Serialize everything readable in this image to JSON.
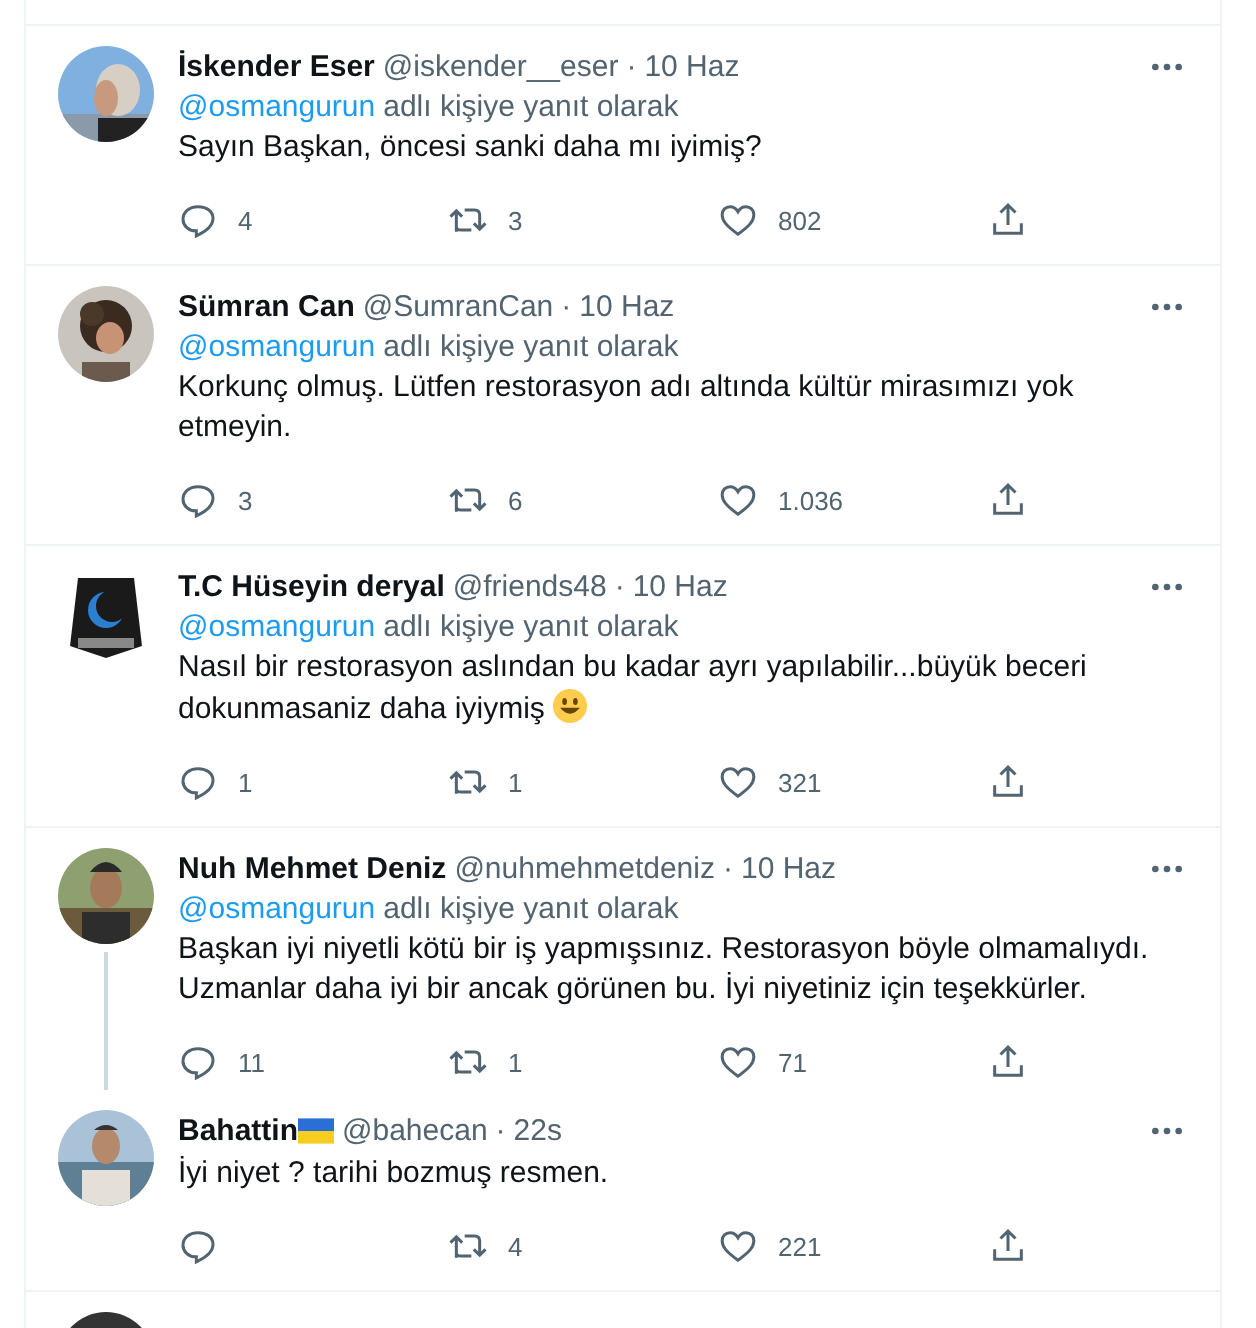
{
  "tweets": [
    {
      "name": "İskender Eser",
      "flag": false,
      "handle": "@iskender__eser",
      "time": "10 Haz",
      "reply_to": "@osmangurun",
      "reply_suffix": "adlı kişiye yanıt olarak",
      "text": "Sayın Başkan, öncesi sanki daha mı iyimiş?",
      "emoji": false,
      "replies": "4",
      "retweets": "3",
      "likes": "802",
      "thread_continues": false,
      "separator": "·"
    },
    {
      "name": "Sümran Can",
      "flag": false,
      "handle": "@SumranCan",
      "time": "10 Haz",
      "reply_to": "@osmangurun",
      "reply_suffix": "adlı kişiye yanıt olarak",
      "text": "Korkunç olmuş. Lütfen restorasyon adı altında kültür mirasımızı yok etmeyin.",
      "emoji": false,
      "replies": "3",
      "retweets": "6",
      "likes": "1.036",
      "thread_continues": false,
      "separator": "·"
    },
    {
      "name": "T.C Hüseyin deryal",
      "flag": false,
      "handle": "@friends48",
      "time": "10 Haz",
      "reply_to": "@osmangurun",
      "reply_suffix": "adlı kişiye yanıt olarak",
      "text": "Nasıl bir restorasyon aslından bu kadar ayrı yapılabilir...büyük beceri dokunmasaniz daha iyiymiş",
      "emoji": true,
      "replies": "1",
      "retweets": "1",
      "likes": "321",
      "thread_continues": false,
      "separator": "·"
    },
    {
      "name": "Nuh Mehmet Deniz",
      "flag": false,
      "handle": "@nuhmehmetdeniz",
      "time": "10 Haz",
      "reply_to": "@osmangurun",
      "reply_suffix": "adlı kişiye yanıt olarak",
      "text": "Başkan iyi niyetli kötü bir iş yapmışsınız. Restorasyon böyle olmamalıydı. Uzmanlar daha iyi bir ancak görünen bu. İyi niyetiniz için teşekkürler.",
      "emoji": false,
      "replies": "11",
      "retweets": "1",
      "likes": "71",
      "thread_continues": true,
      "separator": "·"
    },
    {
      "name": "Bahattin",
      "flag": true,
      "handle": "@bahecan",
      "time": "22s",
      "text": "İyi niyet ? tarihi bozmuş resmen.",
      "emoji": false,
      "retweets": "4",
      "likes": "221",
      "thread_continues": false,
      "separator": "·"
    }
  ]
}
